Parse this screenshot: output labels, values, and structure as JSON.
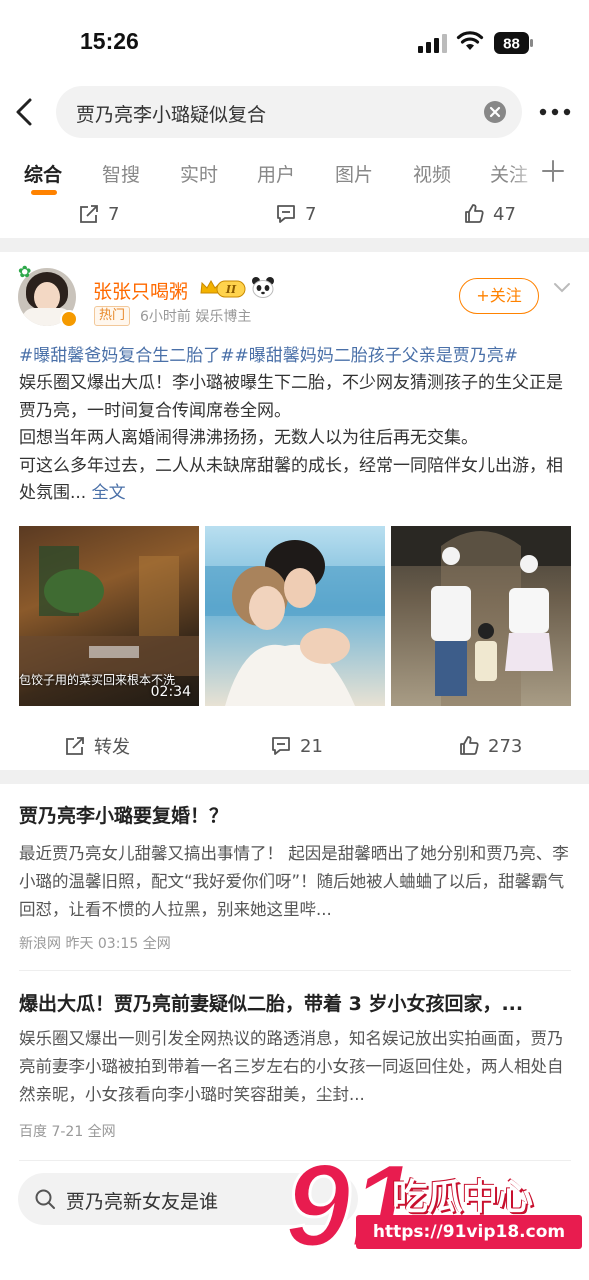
{
  "status_bar": {
    "time": "15:26",
    "battery": "88"
  },
  "search": {
    "query": "贾乃亮李小璐疑似复合"
  },
  "tabs": [
    {
      "label": "综合"
    },
    {
      "label": "智搜"
    },
    {
      "label": "实时"
    },
    {
      "label": "用户"
    },
    {
      "label": "图片"
    },
    {
      "label": "视频"
    },
    {
      "label": "关注"
    }
  ],
  "prev_actions": {
    "repost": "7",
    "comment": "7",
    "like": "47"
  },
  "post": {
    "author": "张张只喝粥",
    "vip_level": "II",
    "hot_tag": "热门",
    "meta": "6小时前  娱乐博主",
    "follow_label": "+关注",
    "hashtags": "#曝甜馨爸妈复合生二胎了##曝甜馨妈妈二胎孩子父亲是贾乃亮#",
    "text_1": "娱乐圈又爆出大瓜！李小璐被曝生下二胎，不少网友猜测孩子的生父正是贾乃亮，一时间复合传闻席卷全网。",
    "text_2": "回想当年两人离婚闹得沸沸扬扬，无数人以为往后再无交集。",
    "text_3": "可这么多年过去，二人从未缺席甜馨的成长，经常一同陪伴女儿出游，相处氛围...",
    "full_text_link": "全文",
    "video_caption": "包饺子用的菜买回来根本不洗",
    "video_duration": "02:34",
    "actions": {
      "repost": "转发",
      "comment": "21",
      "like": "273"
    }
  },
  "articles": [
    {
      "title": "贾乃亮李小璐要复婚！？",
      "body": "最近贾乃亮女儿甜馨又搞出事情了！        起因是甜馨晒出了她分别和贾乃亮、李小璐的温馨旧照，配文“我好爱你们呀”！随后她被人蛐蛐了以后，甜馨霸气回怼，让看不惯的人拉黑，别来她这里哔...",
      "meta": "新浪网 昨天 03:15 全网"
    },
    {
      "title": "爆出大瓜！贾乃亮前妻疑似二胎，带着 3 岁小女孩回家，...",
      "body": "娱乐圈又爆出一则引发全网热议的路透消息，知名娱记放出实拍画面，贾乃亮前妻李小璐被拍到带着一名三岁左右的小女孩一同返回住处，两人相处自然亲昵，小女孩看向李小璐时笑容甜美，尘封...",
      "meta": "百度 7-21 全网"
    }
  ],
  "bottom_search": {
    "text": "贾乃亮新女友是谁"
  },
  "watermark": {
    "brand": "91吃瓜中心",
    "url": "https://91vip18.com"
  },
  "colors": {
    "accent": "#ff8200",
    "link": "#4a70a8",
    "watermark": "#e81c4f"
  }
}
